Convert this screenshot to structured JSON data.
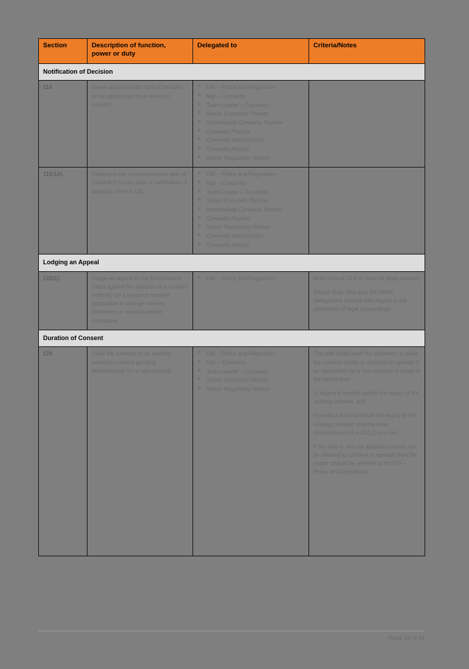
{
  "document": {
    "table": {
      "columns": [
        "Section",
        "Description of function, power or duty",
        "Delegated to",
        "Criteria/Notes"
      ],
      "column_header_lines": {
        "desc_line1": "Description of function,",
        "desc_line2": "power or duty"
      },
      "sections": [
        {
          "band_label": "Notification of Decision",
          "rows": [
            {
              "section": "114",
              "description": "Serve applicant with copy of decision on an application for a resource consent",
              "delegated_to": [
                "GM – Policy and Regulation",
                "Mgr – Consents",
                "Team Leader – Consents",
                "Senior Consents Planner",
                "Intermediate Consents Planner",
                "Consents Planner",
                "Consents Administrator",
                "Consents Advisor",
                "Senior Regulatory Advisor"
              ],
              "criteria_notes": []
            },
            {
              "section": "116(1A)",
              "description": "Determine the commencement date of consent if not the date of notification of decision under s.114.",
              "delegated_to": [
                "GM – Policy and Regulation",
                "Mgr – Consents",
                "Team Leader – Consents",
                "Senior Consents Planner",
                "Intermediate Consents Planner",
                "Consents Planner",
                "Senior Regulatory Advisor",
                "Consents Administrator",
                "Consents Advisor"
              ],
              "criteria_notes": []
            }
          ]
        },
        {
          "band_label": "Lodging an Appeal",
          "rows": [
            {
              "section": "120(1)",
              "description": "Lodge an appeal to the Environment Court against the decision of a consent authority on a resource consent application to change consent conditions or review consent conditions.",
              "delegated_to": [
                "GM – Policy and Regulation"
              ],
              "criteria_notes": [
                "Must consult CLA or external legal counsel.",
                "Advice Note: See also the HBRC Delegations Manual with regard to the settlement of legal proceedings."
              ]
            }
          ]
        },
        {
          "band_label": "Duration of Consent",
          "rows": [
            {
              "section": "124",
              "description": "Allow the exercise of an existing resource consent pending determination for a new consent",
              "delegated_to": [
                "GM – Policy and Regulation",
                "Mgr – Consents",
                "Team Leader – Consents",
                "Senior Consents Planner",
                "Senior Regulatory Advisor"
              ],
              "criteria_notes": [
                "The staff listed have the discretion to allow the consent holder to continue to operate if an application for a new consent is made in the period that—",
                "(i) begins 6 months before the expiry of the existing consent; and",
                "(ii) ends 3 months before the expiry of the existing consent; and the other circumstances in s.124(2) are met.",
                "If the view is that the applicant should not be allowed to continue to operate then the matter should be referred to the GM – Policy and Regulation."
              ]
            }
          ]
        }
      ]
    },
    "footer": {
      "page_label": "Page 18 of 41"
    },
    "colors": {
      "header_orange": "#ee7d28",
      "band_grey": "#dddddd",
      "page_grey": "#7f7f7f",
      "body_text_grey": "#6a6a6a",
      "border_black": "#1a1a1a"
    }
  }
}
